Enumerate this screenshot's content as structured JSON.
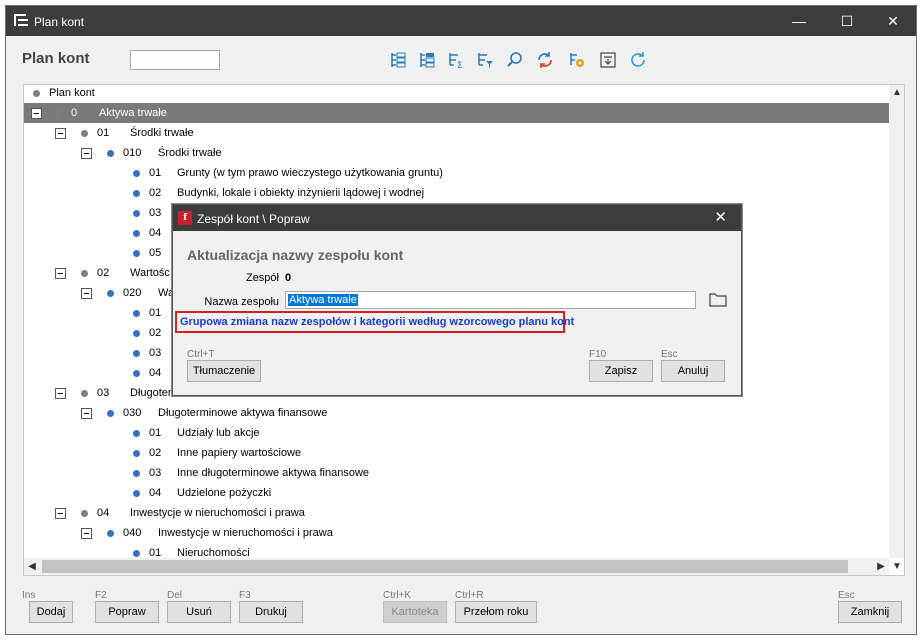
{
  "window": {
    "title": "Plan kont",
    "controls": {
      "minimize": "—",
      "maximize": "☐",
      "close": "✕"
    }
  },
  "header": {
    "label": "Plan kont",
    "search_value": ""
  },
  "toolbar_icons": [
    "tree-expand-icon",
    "tree-collapse-icon",
    "tree-sum-icon",
    "tree-filter-icon",
    "search-icon",
    "sync-icon",
    "settings-folder-icon",
    "export-icon",
    "refresh-icon"
  ],
  "tree": {
    "root_label": "Plan kont",
    "rows": [
      {
        "code": "0",
        "name": "Aktywa trwałe"
      },
      {
        "code": "01",
        "name": "Środki trwałe"
      },
      {
        "code": "010",
        "name": "Środki trwałe"
      },
      {
        "code": "01",
        "name": "Grunty (w tym prawo wieczystego użytkowania gruntu)"
      },
      {
        "code": "02",
        "name": "Budynki, lokale i obiekty inżynierii lądowej i wodnej"
      },
      {
        "code": "03",
        "name": ""
      },
      {
        "code": "04",
        "name": ""
      },
      {
        "code": "05",
        "name": ""
      },
      {
        "code": "02",
        "name": "Wartośc"
      },
      {
        "code": "020",
        "name": "Wa"
      },
      {
        "code": "01",
        "name": ""
      },
      {
        "code": "02",
        "name": ""
      },
      {
        "code": "03",
        "name": ""
      },
      {
        "code": "04",
        "name": ""
      },
      {
        "code": "03",
        "name": "Długoter"
      },
      {
        "code": "030",
        "name": "Długoterminowe aktywa finansowe"
      },
      {
        "code": "01",
        "name": "Udziały lub akcje"
      },
      {
        "code": "02",
        "name": "Inne papiery wartościowe"
      },
      {
        "code": "03",
        "name": "Inne długoterminowe aktywa finansowe"
      },
      {
        "code": "04",
        "name": "Udzielone pożyczki"
      },
      {
        "code": "04",
        "name": "Inwestycje w nieruchomości i prawa"
      },
      {
        "code": "040",
        "name": "Inwestycje w nieruchomości i prawa"
      },
      {
        "code": "01",
        "name": "Nieruchomości"
      }
    ]
  },
  "bottom_bar": {
    "buttons": [
      {
        "hotkey": "Ins",
        "label": "Dodaj"
      },
      {
        "hotkey": "F2",
        "label": "Popraw"
      },
      {
        "hotkey": "Del",
        "label": "Usuń"
      },
      {
        "hotkey": "F3",
        "label": "Drukuj"
      },
      {
        "hotkey": "Ctrl+K",
        "label": "Kartoteka",
        "disabled": true
      },
      {
        "hotkey": "Ctrl+R",
        "label": "Przełom roku"
      },
      {
        "hotkey": "Esc",
        "label": "Zamknij"
      }
    ]
  },
  "dialog": {
    "title": "Zespół kont \\ Popraw",
    "logo": "f",
    "heading": "Aktualizacja nazwy zespołu kont",
    "team_label": "Zespół",
    "team_value": "0",
    "name_label": "Nazwa zespołu",
    "name_value": "Aktywa trwałe",
    "link_text": "Grupowa zmiana nazw zespołów i kategorii według wzorcowego planu kont",
    "translate": {
      "hotkey": "Ctrl+T",
      "label": "Tłumaczenie"
    },
    "save": {
      "hotkey": "F10",
      "label": "Zapisz"
    },
    "cancel": {
      "hotkey": "Esc",
      "label": "Anuluj"
    },
    "close": "✕"
  },
  "colors": {
    "titlebar": "#3c3c3c",
    "selection": "#7a7a7a",
    "link": "#1a3cc2",
    "highlight_border": "#d42020",
    "node_blue": "#3a6ebf"
  }
}
